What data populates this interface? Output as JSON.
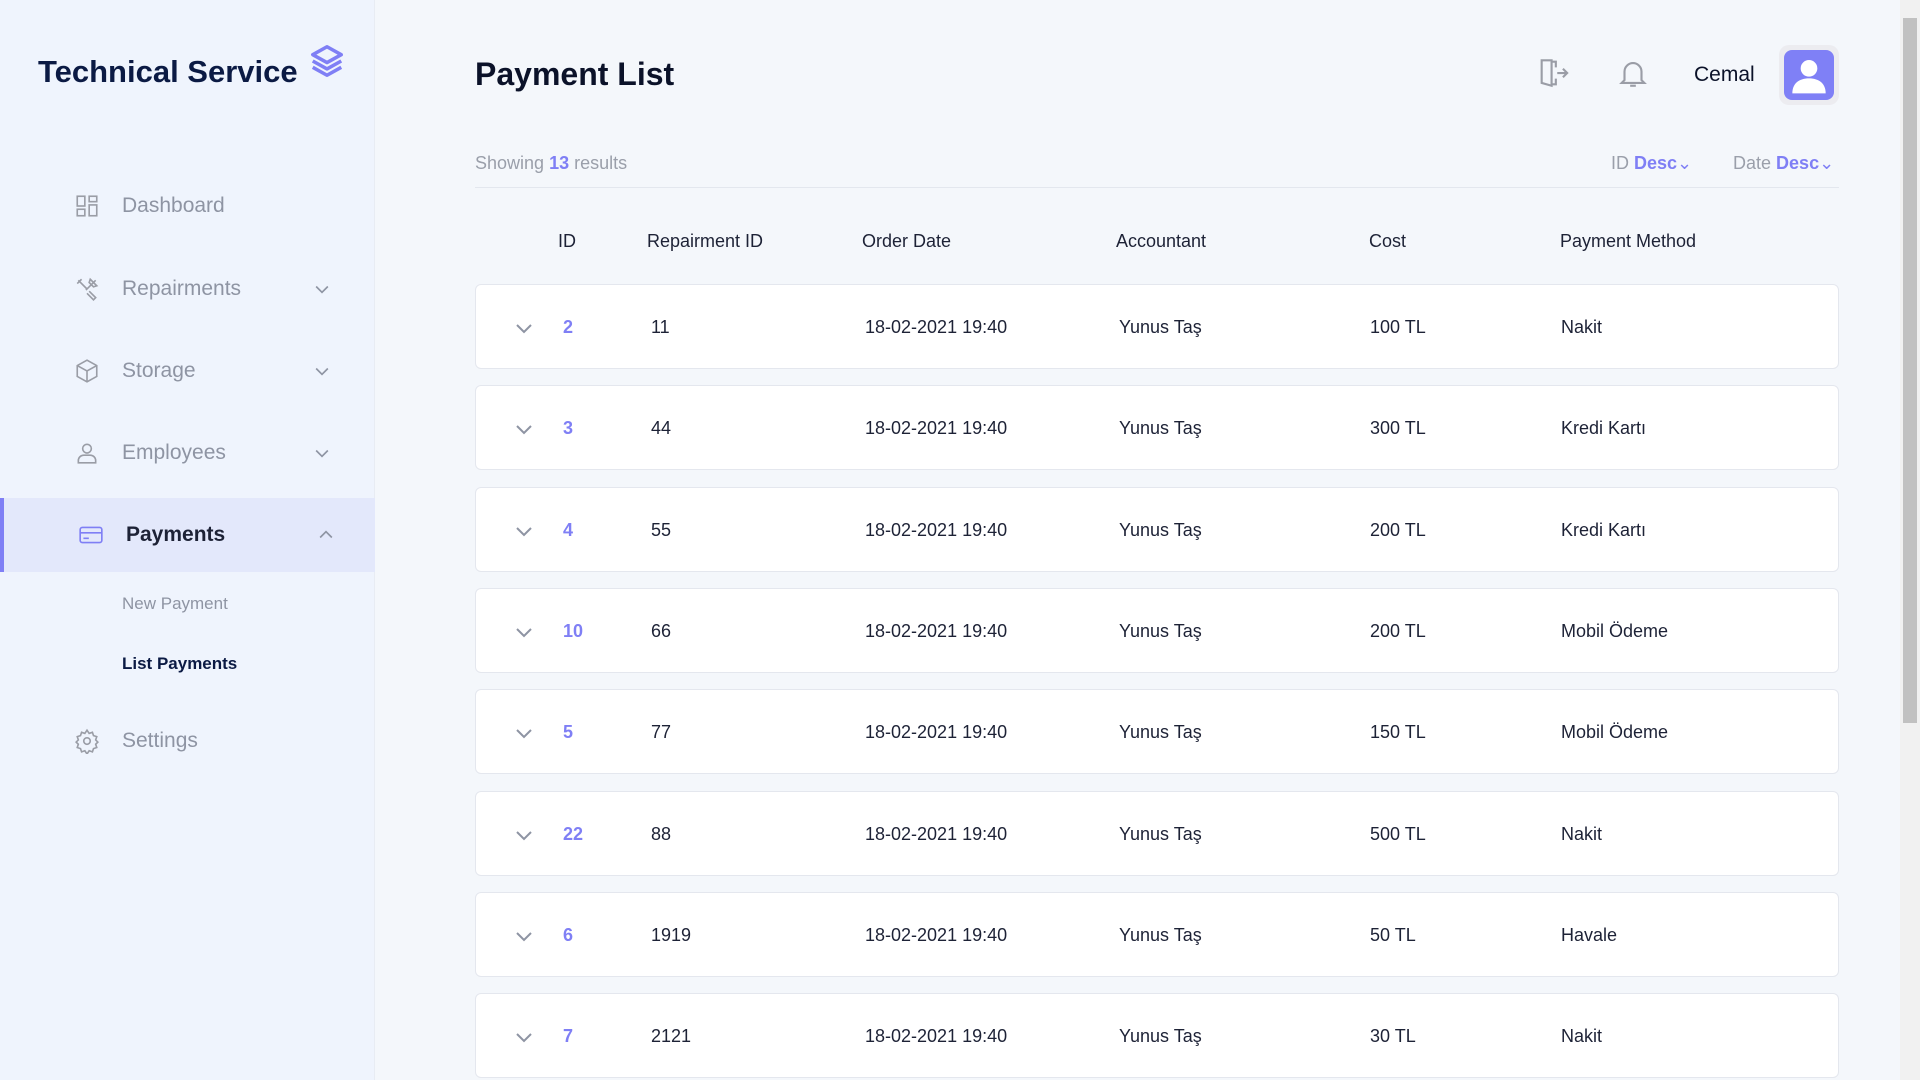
{
  "app": {
    "title": "Technical Service",
    "accent": "#7f7ff5"
  },
  "sidebar": {
    "items": [
      {
        "label": "Dashboard",
        "icon": "dashboard-icon",
        "expandable": false
      },
      {
        "label": "Repairments",
        "icon": "tools-icon",
        "expandable": true
      },
      {
        "label": "Storage",
        "icon": "box-icon",
        "expandable": true
      },
      {
        "label": "Employees",
        "icon": "user-icon",
        "expandable": true
      },
      {
        "label": "Payments",
        "icon": "credit-card-icon",
        "expandable": true,
        "active": true
      },
      {
        "label": "Settings",
        "icon": "gear-icon",
        "expandable": false
      }
    ],
    "subitems": [
      {
        "label": "New Payment"
      },
      {
        "label": "List Payments",
        "active": true
      }
    ]
  },
  "header": {
    "title": "Payment List",
    "user": "Cemal"
  },
  "summary": {
    "prefix": "Showing",
    "count": "13",
    "suffix": "results"
  },
  "sort": [
    {
      "label": "ID",
      "value": "Desc"
    },
    {
      "label": "Date",
      "value": "Desc"
    }
  ],
  "table": {
    "columns": [
      "ID",
      "Repairment ID",
      "Order Date",
      "Accountant",
      "Cost",
      "Payment Method"
    ],
    "rows": [
      [
        "2",
        "11",
        "18-02-2021 19:40",
        "Yunus Taş",
        "100 TL",
        "Nakit"
      ],
      [
        "3",
        "44",
        "18-02-2021 19:40",
        "Yunus Taş",
        "300 TL",
        "Kredi Kartı"
      ],
      [
        "4",
        "55",
        "18-02-2021 19:40",
        "Yunus Taş",
        "200 TL",
        "Kredi Kartı"
      ],
      [
        "10",
        "66",
        "18-02-2021 19:40",
        "Yunus Taş",
        "200 TL",
        "Mobil Ödeme"
      ],
      [
        "5",
        "77",
        "18-02-2021 19:40",
        "Yunus Taş",
        "150 TL",
        "Mobil Ödeme"
      ],
      [
        "22",
        "88",
        "18-02-2021 19:40",
        "Yunus Taş",
        "500 TL",
        "Nakit"
      ],
      [
        "6",
        "1919",
        "18-02-2021 19:40",
        "Yunus Taş",
        "50 TL",
        "Havale"
      ],
      [
        "7",
        "2121",
        "18-02-2021 19:40",
        "Yunus Taş",
        "30 TL",
        "Nakit"
      ]
    ]
  }
}
